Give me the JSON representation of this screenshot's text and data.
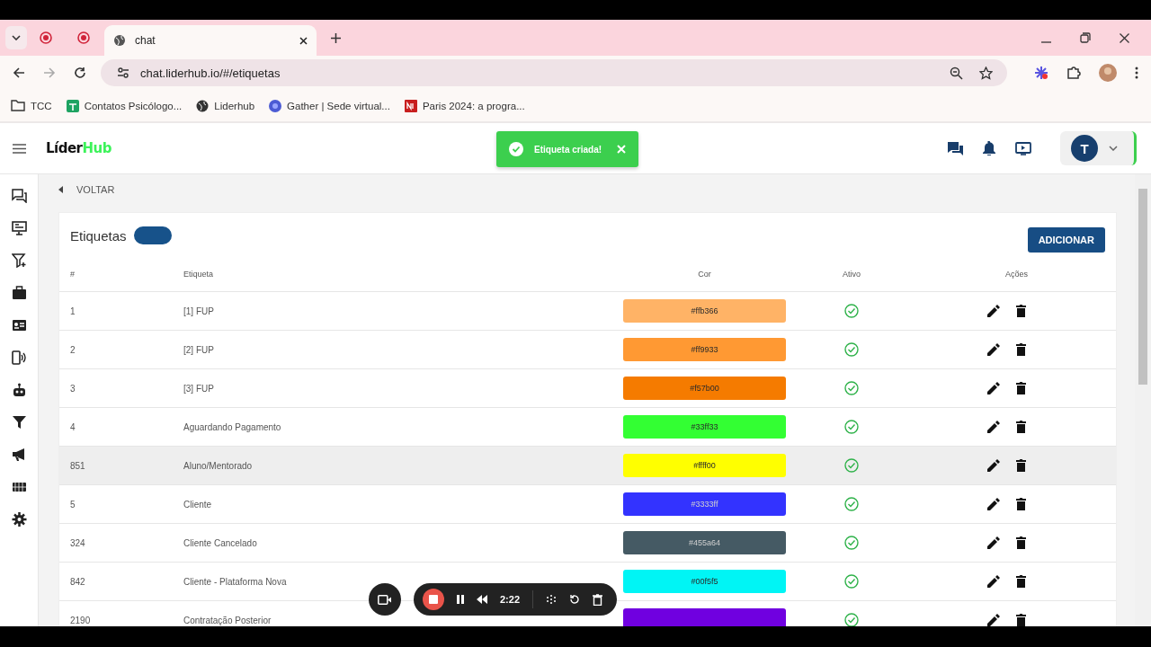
{
  "browser": {
    "tabs": [
      {
        "kind": "pinned",
        "selected": false
      },
      {
        "kind": "pinned",
        "selected": false
      },
      {
        "kind": "page",
        "title": "chat",
        "selected": true
      }
    ],
    "url": "chat.liderhub.io/#/etiquetas",
    "bookmarks": [
      {
        "kind": "folder",
        "label": "TCC"
      },
      {
        "kind": "sheet",
        "label": "Contatos Psicólogo..."
      },
      {
        "kind": "globe",
        "label": "Liderhub"
      },
      {
        "kind": "gather",
        "label": "Gather | Sede virtual..."
      },
      {
        "kind": "news",
        "label": "Paris 2024: a progra..."
      }
    ]
  },
  "header": {
    "logo_dark": "Líder",
    "logo_light": "Hub",
    "avatar": "T"
  },
  "toast": {
    "message": "Etiqueta criada!"
  },
  "back": "VOLTAR",
  "card": {
    "title": "Etiquetas",
    "add_button": "ADICIONAR",
    "columns": [
      "#",
      "Etiqueta",
      "Cor",
      "Ativo",
      "Ações"
    ],
    "rows": [
      {
        "id": "1",
        "name": "[1] FUP",
        "color": "#ffb366",
        "color_label": "#ffb366",
        "active": true,
        "highlighted": false
      },
      {
        "id": "2",
        "name": "[2] FUP",
        "color": "#ff9933",
        "color_label": "#ff9933",
        "active": true,
        "highlighted": false
      },
      {
        "id": "3",
        "name": "[3] FUP",
        "color": "#f57b00",
        "color_label": "#f57b00",
        "active": true,
        "highlighted": false
      },
      {
        "id": "4",
        "name": "Aguardando Pagamento",
        "color": "#33ff33",
        "color_label": "#33ff33",
        "active": true,
        "highlighted": false
      },
      {
        "id": "851",
        "name": "Aluno/Mentorado",
        "color": "#ffff00",
        "color_label": "#ffff00",
        "active": true,
        "highlighted": true
      },
      {
        "id": "5",
        "name": "Cliente",
        "color": "#3333ff",
        "color_label": "#3333ff",
        "active": true,
        "highlighted": false
      },
      {
        "id": "324",
        "name": "Cliente Cancelado",
        "color": "#455a64",
        "color_label": "#455a64",
        "active": true,
        "highlighted": false
      },
      {
        "id": "842",
        "name": "Cliente - Plataforma Nova",
        "color": "#00f5f5",
        "color_label": "#00f5f5",
        "active": true,
        "highlighted": false
      },
      {
        "id": "2190",
        "name": "Contratação Posterior",
        "color": "#7000e0",
        "active": true,
        "highlighted": false
      }
    ]
  },
  "recorder": {
    "time": "2:22"
  }
}
